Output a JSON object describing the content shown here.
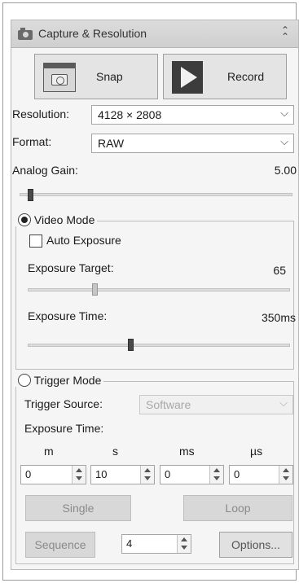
{
  "panel": {
    "title": "Capture & Resolution",
    "collapse_icon": "chevron-double-up-icon"
  },
  "capture": {
    "snap_label": "Snap",
    "record_label": "Record"
  },
  "resolution": {
    "label": "Resolution:",
    "value": "4128 × 2808"
  },
  "format": {
    "label": "Format:",
    "value": "RAW"
  },
  "analog_gain": {
    "label": "Analog Gain:",
    "value": "5.00",
    "slider_fraction": 0.03
  },
  "video_mode": {
    "label": "Video Mode",
    "selected": true,
    "auto_exposure_label": "Auto Exposure",
    "auto_exposure_checked": false,
    "exposure_target_label": "Exposure Target:",
    "exposure_target_value": "65",
    "exposure_target_fraction": 0.25,
    "exposure_time_label": "Exposure Time:",
    "exposure_time_value": "350ms",
    "exposure_time_fraction": 0.39
  },
  "trigger_mode": {
    "label": "Trigger Mode",
    "selected": false,
    "source_label": "Trigger Source:",
    "source_value": "Software",
    "exposure_time_label": "Exposure Time:",
    "units": [
      "m",
      "s",
      "ms",
      "µs"
    ],
    "values": [
      "0",
      "10",
      "0",
      "0"
    ],
    "single_label": "Single",
    "loop_label": "Loop",
    "sequence_label": "Sequence",
    "sequence_count": "4",
    "options_label": "Options..."
  }
}
